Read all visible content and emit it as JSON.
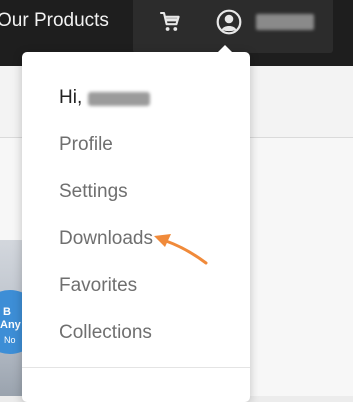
{
  "nav": {
    "products_label": "Our Products",
    "cart_icon": "shopping-cart-icon",
    "account_icon": "user-circle-icon"
  },
  "dropdown": {
    "greeting": "Hi,",
    "items": [
      {
        "label": "Profile"
      },
      {
        "label": "Settings"
      },
      {
        "label": "Downloads"
      },
      {
        "label": "Favorites"
      },
      {
        "label": "Collections"
      }
    ]
  },
  "banner": {
    "line1": "B",
    "line2": "Any",
    "line3": "No"
  },
  "colors": {
    "topbar": "#1e1e1e",
    "account_box": "#2c2c2c",
    "menu_text": "#6f6f6f",
    "annotation_arrow": "#f08a3a"
  }
}
